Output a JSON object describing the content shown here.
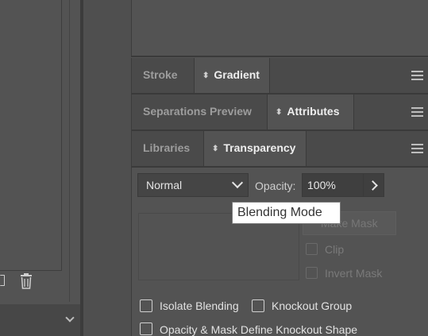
{
  "panels": {
    "group1": {
      "tabs": [
        {
          "label": "Stroke",
          "active": false
        },
        {
          "label": "Gradient",
          "active": true
        }
      ]
    },
    "group2": {
      "tabs": [
        {
          "label": "Separations Preview",
          "active": false
        },
        {
          "label": "Attributes",
          "active": true
        }
      ]
    },
    "group3": {
      "tabs": [
        {
          "label": "Libraries",
          "active": false
        },
        {
          "label": "Transparency",
          "active": true
        }
      ]
    }
  },
  "transparency": {
    "blend_mode": "Normal",
    "opacity_label": "Opacity:",
    "opacity_value": "100%",
    "make_mask_label": "Make Mask",
    "clip_label": "Clip",
    "invert_mask_label": "Invert Mask",
    "isolate_blending_label": "Isolate Blending",
    "knockout_group_label": "Knockout Group",
    "opacity_mask_knockout_label": "Opacity & Mask Define Knockout Shape"
  },
  "tooltip": {
    "text": "Blending Mode"
  },
  "icons": {
    "panel_menu": "hamburger-icon",
    "tab_arrows": "up-down-arrows-icon",
    "delete": "trash-icon",
    "blend_dropdown": "chevron-down-icon",
    "opacity_expand": "chevron-right-icon"
  }
}
